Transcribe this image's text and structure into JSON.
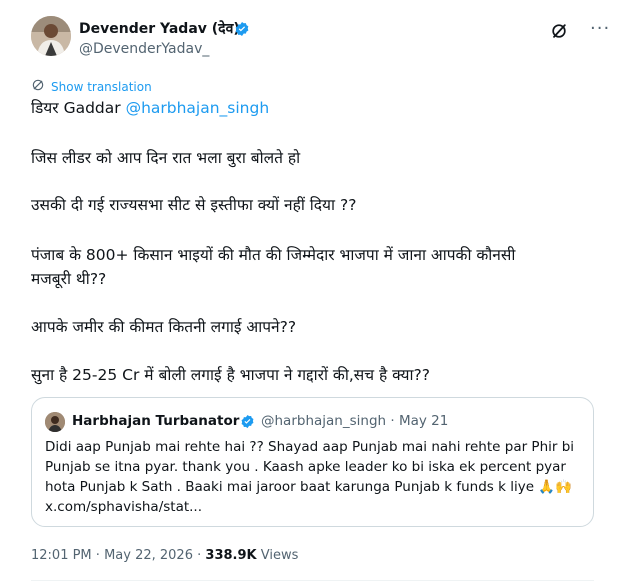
{
  "author": {
    "name": "Devender Yadav (देव)",
    "handle": "@DevenderYadav_",
    "verified": true
  },
  "translate_label": "Show translation",
  "tweet": {
    "line1_prefix": "डियर Gaddar",
    "line1_mention": "@harbhajan_singh",
    "line2": "जिस लीडर को आप दिन रात भला बुरा बोलते हो",
    "line3": "उसकी दी गई राज्यसभा सीट से इस्तीफा क्यों नहीं दिया ??",
    "line4a": "पंजाब के 800+ किसान भाइयों की मौत की जिम्मेदार भाजपा में जाना आपकी कौनसी",
    "line4b": "मजबूरी थी??",
    "line5": "आपके जमीर की कीमत कितनी लगाई आपने??",
    "line6": "सुना है 25-25 Cr में बोली लगाई है भाजपा ने गद्दारों की,सच है क्या??"
  },
  "quote": {
    "name": "Harbhajan Turbanator",
    "handle": "@harbhajan_singh",
    "separator": "·",
    "date": "May 21",
    "lines": [
      "Didi aap Punjab mai rehte hai ?? Shayad aap Punjab  mai nahi rehte par Phir bi",
      "Punjab se itna pyar. thank you . Kaash apke leader ko bi iska ek percent pyar",
      "hota Punjab  k Sath . Baaki mai jaroor baat karunga Punjab k funds k liye 🙏🙌",
      "x.com/sphavisha/stat..."
    ]
  },
  "meta": {
    "time": "12:01 PM",
    "dot1": "·",
    "date": "May 22, 2026",
    "dot2": "·",
    "views_count": "338.9K",
    "views_label": "Views"
  },
  "colors": {
    "accent": "#1d9bf0",
    "secondary_text": "#536471",
    "primary_text": "#0f1419",
    "border": "#cfd9de"
  },
  "icons": [
    "verified-badge-icon",
    "grok-icon",
    "more-icon",
    "translate-icon"
  ]
}
